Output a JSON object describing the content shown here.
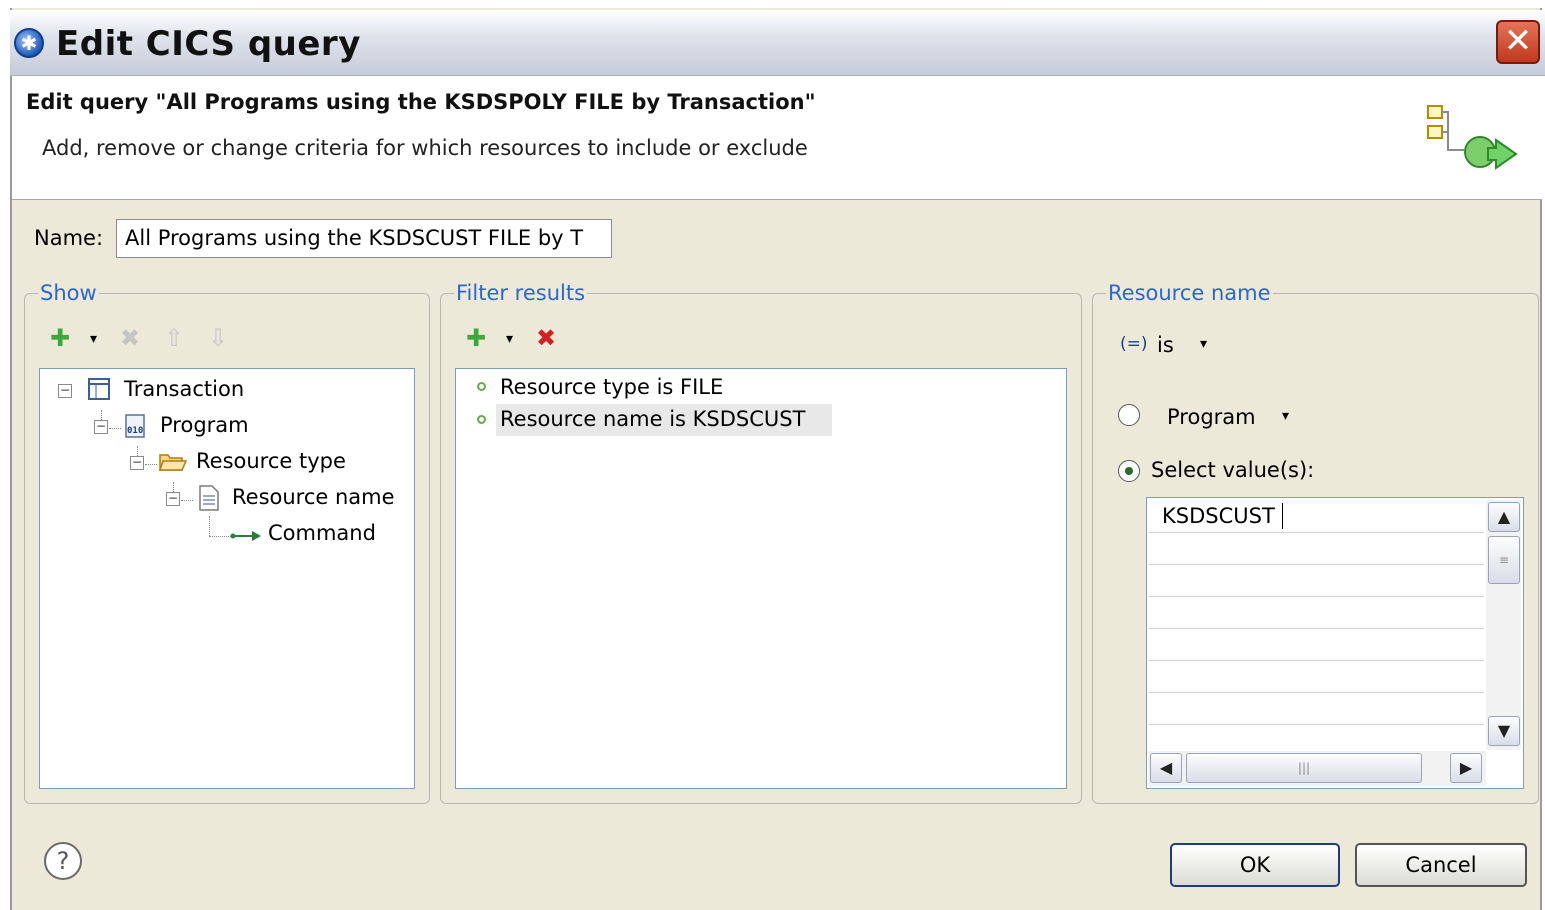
{
  "window": {
    "title": "Edit CICS query",
    "close_glyph": "✕"
  },
  "header": {
    "title": "Edit query \"All Programs using the KSDSPOLY FILE by Transaction\"",
    "description": "Add, remove or change criteria for which resources to include or exclude"
  },
  "name": {
    "label": "Name:",
    "value": "All Programs using the KSDSCUST FILE by T"
  },
  "show": {
    "legend": "Show",
    "tree": [
      {
        "label": "Transaction",
        "icon": "table-icon"
      },
      {
        "label": "Program",
        "icon": "binary-file-icon"
      },
      {
        "label": "Resource type",
        "icon": "folder-open-icon"
      },
      {
        "label": "Resource name",
        "icon": "document-icon"
      },
      {
        "label": "Command",
        "icon": "arrow-right-icon"
      }
    ]
  },
  "filter": {
    "legend": "Filter results",
    "items": [
      "Resource type is FILE",
      "Resource name is KSDSCUST"
    ]
  },
  "resource_name": {
    "legend": "Resource name",
    "operator": "is",
    "operator_glyph": "(=)",
    "radio_program_label": "Program",
    "radio_select_label": "Select value(s):",
    "value": "KSDSCUST"
  },
  "buttons": {
    "ok": "OK",
    "cancel": "Cancel",
    "help_glyph": "?"
  },
  "colors": {
    "legend": "#2c66cf",
    "add": "#3aa83a",
    "delete": "#d42020"
  }
}
